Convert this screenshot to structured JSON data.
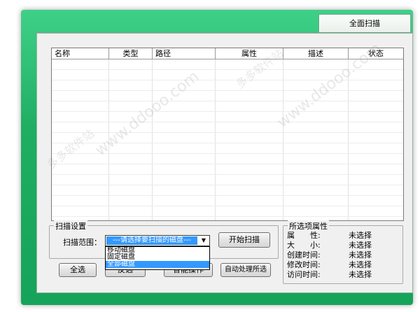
{
  "tab": {
    "label": "全面扫描"
  },
  "table": {
    "columns": [
      "名称",
      "类型",
      "路径",
      "属性",
      "描述",
      "状态"
    ]
  },
  "scan_settings": {
    "group_title": "扫描设置",
    "range_label": "扫描范围：",
    "select_value": "---请选择要扫描的磁盘---",
    "options": [
      "移动磁盘",
      "固定磁盘",
      "全部磁盘"
    ],
    "start_button": "开始扫描"
  },
  "bottom_buttons": {
    "select_all": "全选",
    "invert": "反选",
    "batch": "智能操作",
    "auto_process": "自动处理所选"
  },
  "selected_props": {
    "group_title": "所选项属性",
    "rows": [
      {
        "key": "属　　性:",
        "value": "未选择"
      },
      {
        "key": "大　　小:",
        "value": "未选择"
      },
      {
        "key": "创建时间:",
        "value": "未选择"
      },
      {
        "key": "修改时间:",
        "value": "未选择"
      },
      {
        "key": "访问时间:",
        "value": "未选择"
      }
    ]
  },
  "watermarks": {
    "site": "www.ddooo.com",
    "brand": "多多软件站"
  },
  "colors": {
    "frame_green": "#1fae62",
    "selection_blue": "#3399ff"
  }
}
